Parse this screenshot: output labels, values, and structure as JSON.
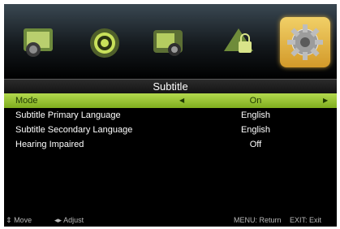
{
  "menu": {
    "tabs": [
      {
        "icon": "picture-icon"
      },
      {
        "icon": "sound-icon"
      },
      {
        "icon": "channel-icon"
      },
      {
        "icon": "lock-icon"
      },
      {
        "icon": "setup-gear-icon",
        "active": true
      }
    ],
    "title": "Subtitle",
    "rows": [
      {
        "label": "Mode",
        "value": "On",
        "selected": true
      },
      {
        "label": "Subtitle Primary Language",
        "value": "English"
      },
      {
        "label": "Subtitle Secondary Language",
        "value": "English"
      },
      {
        "label": "Hearing Impaired",
        "value": "Off"
      }
    ]
  },
  "footer": {
    "move": "Move",
    "adjust": "Adjust",
    "menu_hint": "MENU: Return",
    "exit_hint": "EXIT: Exit"
  },
  "colors": {
    "selected_row": "#9fc83a",
    "active_tab": "#e6b44a"
  }
}
